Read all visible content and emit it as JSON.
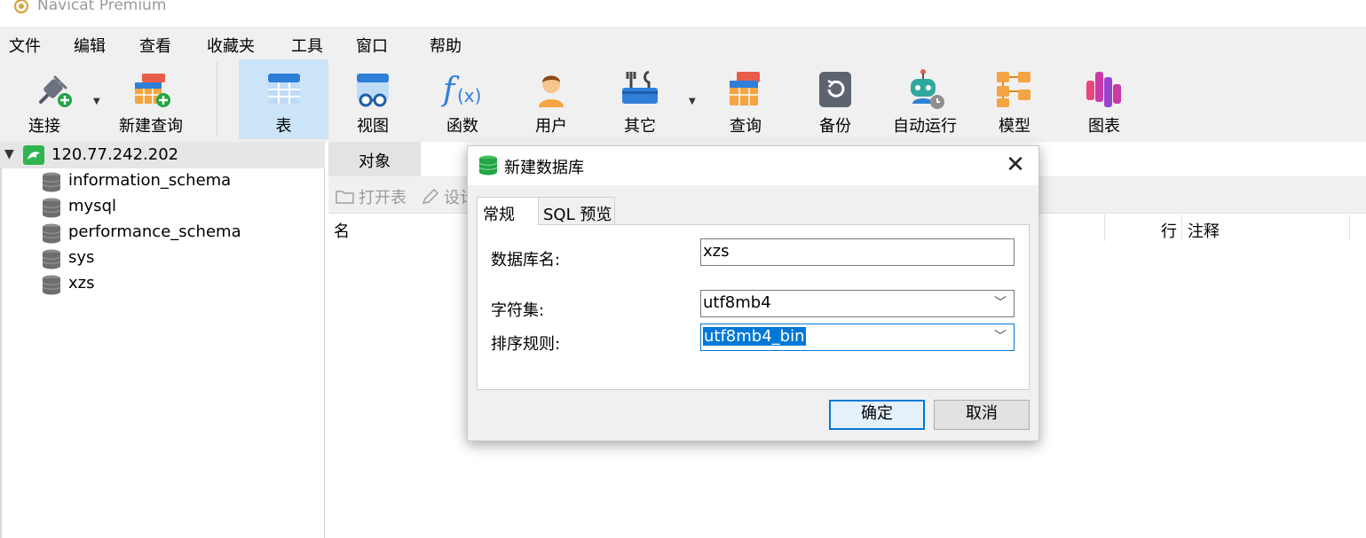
{
  "window": {
    "title": "Navicat Premium"
  },
  "menu": [
    "文件",
    "编辑",
    "查看",
    "收藏夹",
    "工具",
    "窗口",
    "帮助"
  ],
  "toolbar": {
    "connect": "连接",
    "new_query": "新建查询",
    "table": "表",
    "view": "视图",
    "function": "函数",
    "user": "用户",
    "other": "其它",
    "query": "查询",
    "backup": "备份",
    "automation": "自动运行",
    "model": "模型",
    "chart": "图表"
  },
  "tree": {
    "connection": "120.77.242.202",
    "databases": [
      "information_schema",
      "mysql",
      "performance_schema",
      "sys",
      "xzs"
    ]
  },
  "objects": {
    "tab": "对象",
    "open_table": "打开表",
    "design": "设计",
    "col_name": "名",
    "col_rows": "行",
    "col_comment": "注释"
  },
  "dialog": {
    "title": "新建数据库",
    "tabs": [
      "常规",
      "SQL 预览"
    ],
    "active_tab": "常规",
    "db_name_label": "数据库名:",
    "db_name_value": "xzs",
    "charset_label": "字符集:",
    "charset_value": "utf8mb4",
    "collation_label": "排序规则:",
    "collation_value": "utf8mb4_bin",
    "ok": "确定",
    "cancel": "取消"
  },
  "colors": {
    "accent": "#0078d7",
    "toolbar_bg": "#f0f0f0",
    "active_toolbar": "#cce4f7",
    "selected_tree_row": "#e6e6e6"
  }
}
